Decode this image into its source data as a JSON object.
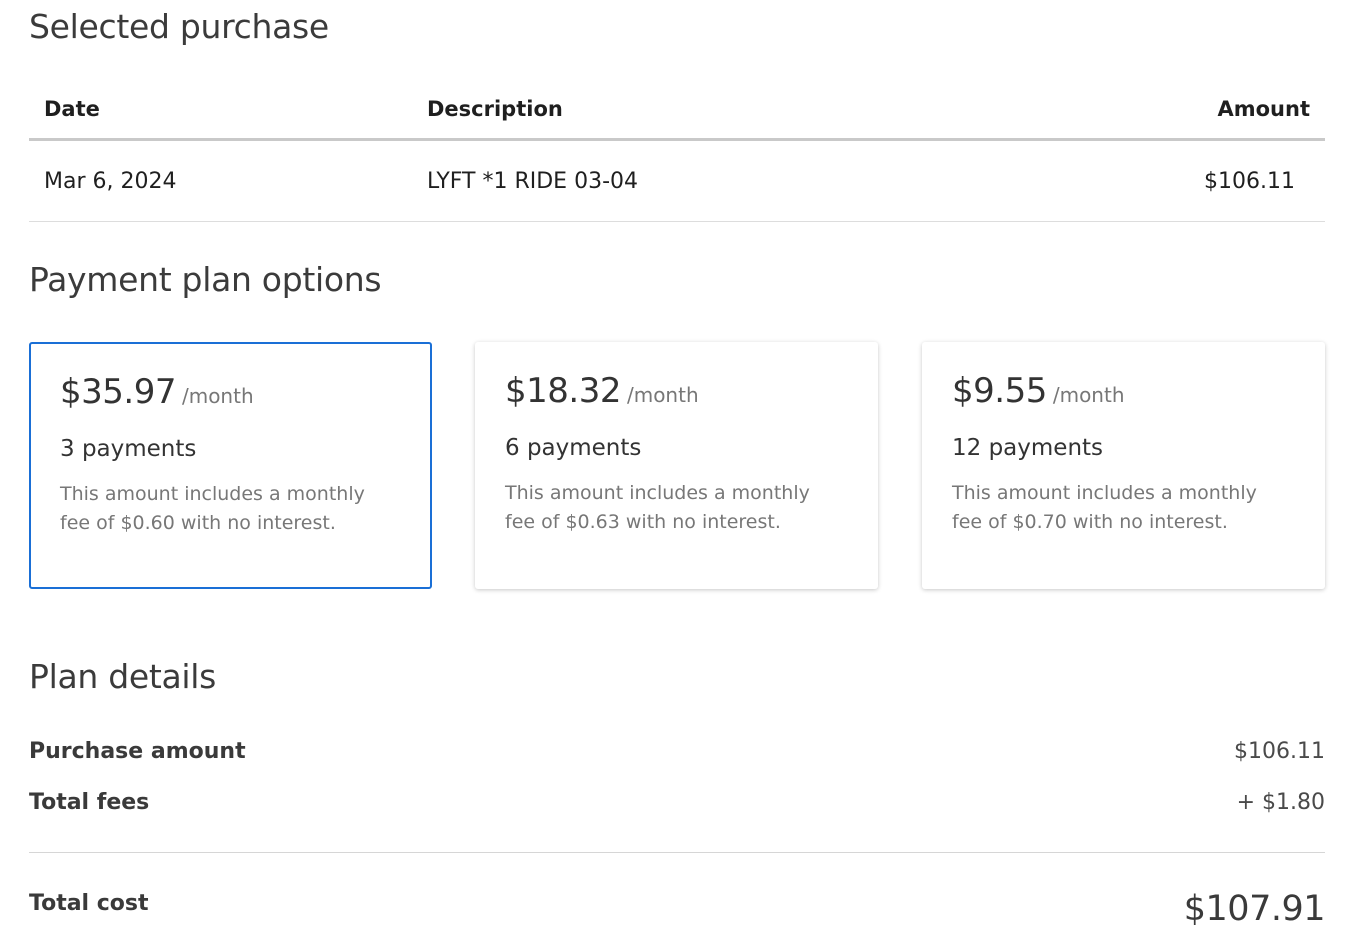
{
  "selected_purchase": {
    "title": "Selected purchase",
    "columns": {
      "date": "Date",
      "description": "Description",
      "amount": "Amount"
    },
    "rows": [
      {
        "date": "Mar 6, 2024",
        "description": "LYFT *1 RIDE 03-04",
        "amount": "$106.11"
      }
    ]
  },
  "payment_plan_options": {
    "title": "Payment plan options",
    "selected_index": 0,
    "accent_color": "#1a6fd6",
    "options": [
      {
        "monthly_amount": "$35.97",
        "per_label": "/month",
        "payments": "3 payments",
        "fee_note": "This amount includes a monthly fee of $0.60 with no interest."
      },
      {
        "monthly_amount": "$18.32",
        "per_label": "/month",
        "payments": "6 payments",
        "fee_note": "This amount includes a monthly fee of $0.63 with no interest."
      },
      {
        "monthly_amount": "$9.55",
        "per_label": "/month",
        "payments": "12 payments",
        "fee_note": "This amount includes a monthly fee of $0.70 with no interest."
      }
    ]
  },
  "plan_details": {
    "title": "Plan details",
    "purchase_amount": {
      "label": "Purchase amount",
      "value": "$106.11"
    },
    "total_fees": {
      "label": "Total fees",
      "value": "+ $1.80"
    },
    "total_cost": {
      "label": "Total cost",
      "value": "$107.91"
    }
  }
}
